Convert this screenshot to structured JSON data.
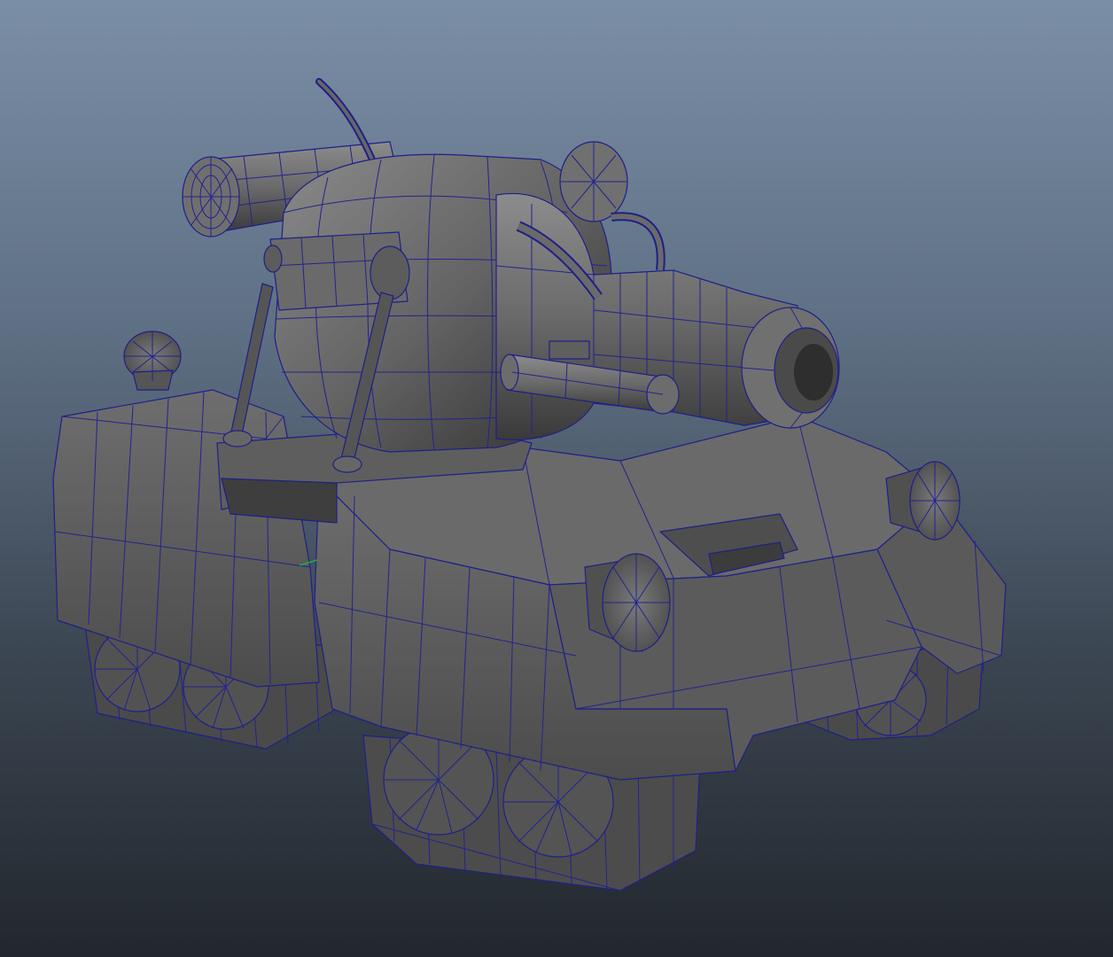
{
  "viewport": {
    "view": "perspective",
    "display_mode": "wireframe-on-shaded",
    "background": {
      "top": "#7a8ea6",
      "bottom": "#22272d"
    },
    "wire_color": "#1f1f8a",
    "surface_color": "#5f5f5f"
  },
  "model": {
    "type": "tank",
    "parts": [
      "hull",
      "turret-dome",
      "main-cannon",
      "rear-cannon",
      "antenna",
      "headlights",
      "side-gun",
      "tracks"
    ]
  }
}
